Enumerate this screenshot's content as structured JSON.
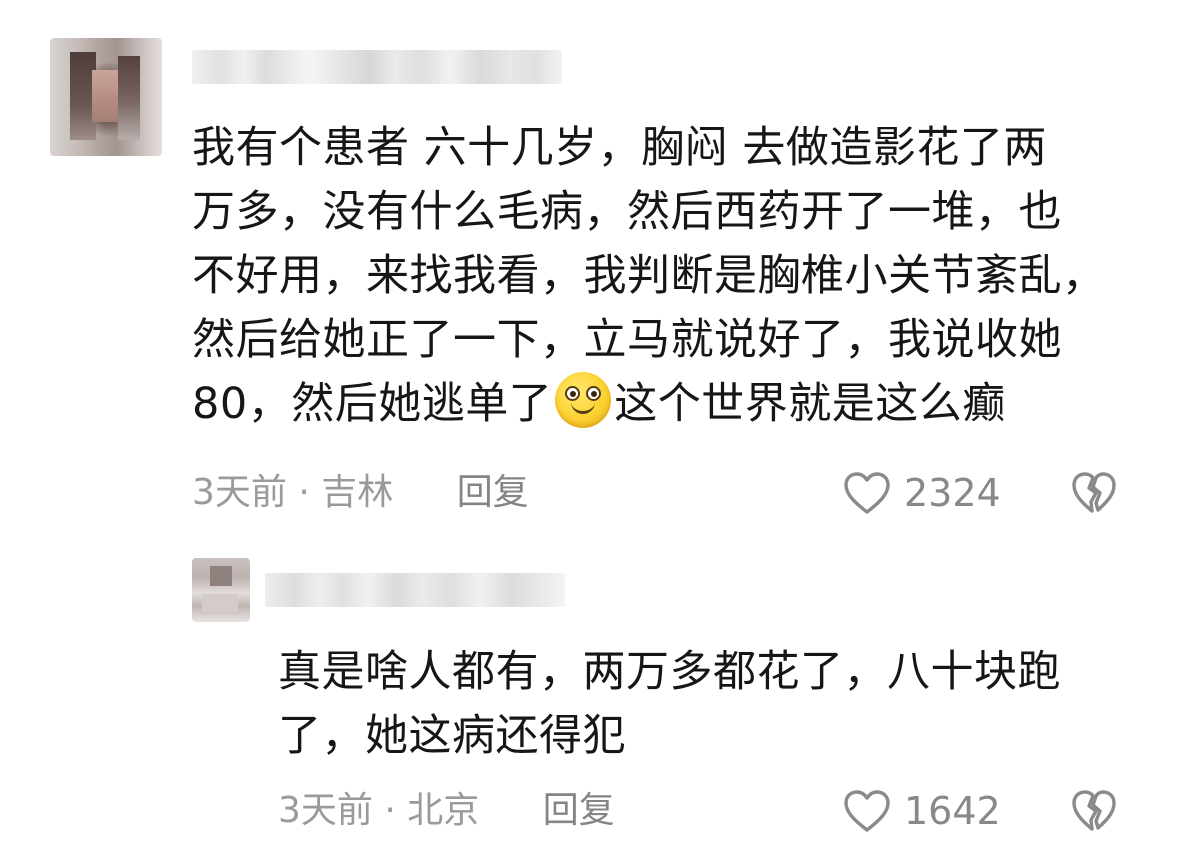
{
  "comments": [
    {
      "lines": [
        "我有个患者 六十几岁，胸闷 去做造影花了两",
        "万多，没有什么毛病，然后西药开了一堆，也",
        "不好用，来找我看，我判断是胸椎小关节紊乱，",
        "然后给她正了一下，立马就说好了，我说收她"
      ],
      "last_line_before_emoji": "80，然后她逃单了",
      "emoji": "smiling-face-emoji",
      "last_line_after_emoji": "这个世界就是这么癫",
      "time": "3天前",
      "separator": "·",
      "location": "吉林",
      "reply_label": "回复",
      "likes": "2324"
    },
    {
      "lines": [
        "真是啥人都有，两万多都花了，八十块跑",
        "了，她这病还得犯"
      ],
      "time": "3天前",
      "separator": "·",
      "location": "北京",
      "reply_label": "回复",
      "likes": "1642"
    }
  ],
  "icons": {
    "like": "heart-outline-icon",
    "dislike": "broken-heart-icon"
  },
  "colors": {
    "text": "#161616",
    "meta": "#9a9a9a",
    "icon": "#8a8a8a"
  }
}
